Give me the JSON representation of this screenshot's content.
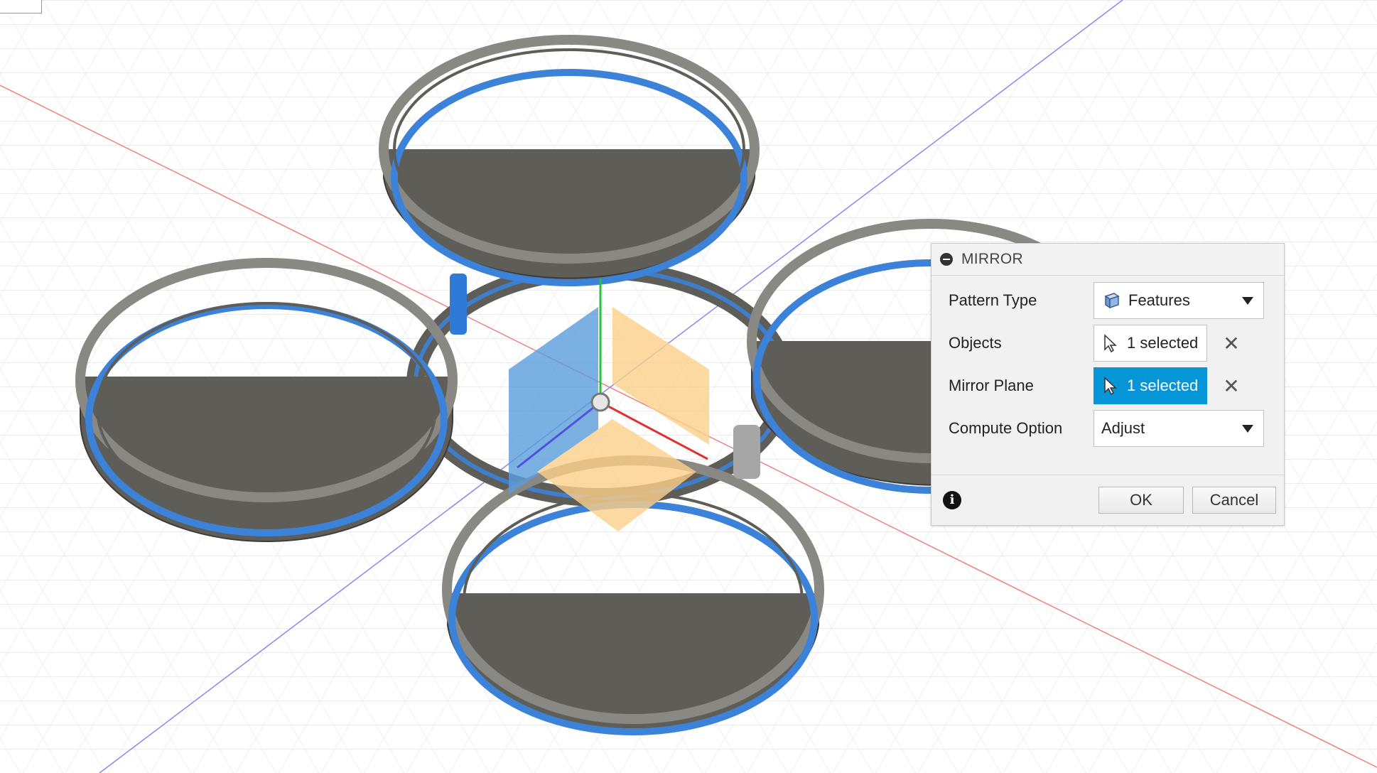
{
  "dialog": {
    "title": "MIRROR",
    "rows": {
      "pattern_type": {
        "label": "Pattern Type",
        "value": "Features"
      },
      "objects": {
        "label": "Objects",
        "value": "1 selected"
      },
      "mirror_plane": {
        "label": "Mirror Plane",
        "value": "1 selected"
      },
      "compute_option": {
        "label": "Compute Option",
        "value": "Adjust"
      }
    },
    "buttons": {
      "ok": "OK",
      "cancel": "Cancel"
    },
    "clear_glyph": "✕",
    "info_glyph": "i"
  },
  "colors": {
    "active_selection": "#0696d7",
    "selection_outline": "#3b82d8",
    "body_fill": "#6e6c66",
    "plane_blue": "#5b9ddc",
    "plane_orange": "#fcd089",
    "x_axis": "#e03030",
    "y_axis": "#27c040",
    "z_axis": "#5050e0"
  }
}
